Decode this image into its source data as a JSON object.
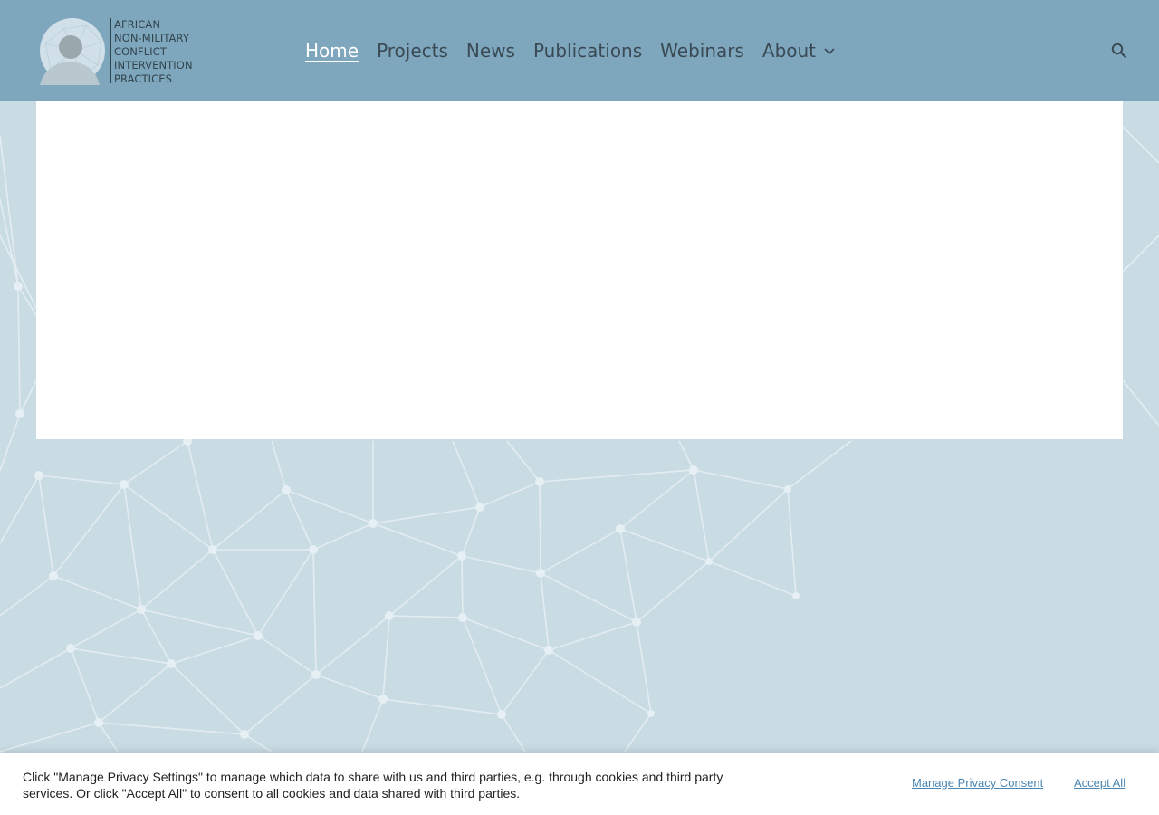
{
  "site": {
    "logo_lines": [
      "AFRICAN",
      "NON-MILITARY",
      "CONFLICT",
      "INTERVENTION",
      "PRACTICES"
    ]
  },
  "nav": {
    "items": [
      {
        "label": "Home",
        "active": true
      },
      {
        "label": "Projects"
      },
      {
        "label": "News"
      },
      {
        "label": "Publications"
      },
      {
        "label": "Webinars"
      },
      {
        "label": "About",
        "has_dropdown": true
      }
    ]
  },
  "icons": {
    "search": "search-icon",
    "dropdown": "chevron-down-icon"
  },
  "cookie": {
    "text": "Click \"Manage Privacy Settings\" to manage which data to share with us and third parties, e.g. through cookies and third party services. Or click \"Accept All\" to consent to all cookies and data shared with third parties.",
    "manage_label": "Manage Privacy Consent",
    "accept_label": "Accept All"
  },
  "colors": {
    "header": "#7ea7be",
    "background": "#c9dbe3",
    "nav_text": "#3a4a55",
    "nav_active": "#ffffff",
    "link": "#4a86b4"
  }
}
